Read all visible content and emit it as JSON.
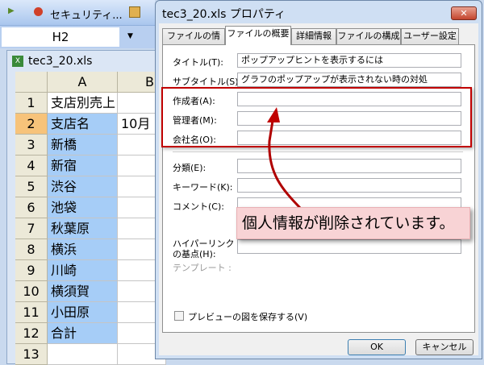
{
  "toolbar": {
    "security_label": "セキュリティ..."
  },
  "namebox": {
    "value": "H2"
  },
  "workbook": {
    "title": "tec3_20.xls",
    "col_a": "A",
    "col_b": "B",
    "rows": [
      {
        "n": "1",
        "a": "支店別売上",
        "b": ""
      },
      {
        "n": "2",
        "a": "支店名",
        "b": "10月"
      },
      {
        "n": "3",
        "a": "新橋",
        "b": ""
      },
      {
        "n": "4",
        "a": "新宿",
        "b": ""
      },
      {
        "n": "5",
        "a": "渋谷",
        "b": ""
      },
      {
        "n": "6",
        "a": "池袋",
        "b": ""
      },
      {
        "n": "7",
        "a": "秋葉原",
        "b": ""
      },
      {
        "n": "8",
        "a": "横浜",
        "b": ""
      },
      {
        "n": "9",
        "a": "川崎",
        "b": ""
      },
      {
        "n": "10",
        "a": "横須賀",
        "b": ""
      },
      {
        "n": "11",
        "a": "小田原",
        "b": ""
      },
      {
        "n": "12",
        "a": "合計",
        "b": ""
      },
      {
        "n": "13",
        "a": "",
        "b": ""
      }
    ]
  },
  "dialog": {
    "title": "tec3_20.xls プロパティ",
    "close": "✕",
    "tabs": [
      "ファイルの情報",
      "ファイルの概要",
      "詳細情報",
      "ファイルの構成",
      "ユーザー設定"
    ],
    "fields": {
      "title_label": "タイトル(T):",
      "title_value": "ポップアップヒントを表示するには",
      "subtitle_label": "サブタイトル(S):",
      "subtitle_value": "グラフのポップアップが表示されない時の対処",
      "author_label": "作成者(A):",
      "manager_label": "管理者(M):",
      "company_label": "会社名(O):",
      "category_label": "分類(E):",
      "keyword_label": "キーワード(K):",
      "comment_label": "コメント(C):",
      "hyperlink_label1": "ハイパーリンク",
      "hyperlink_label2": "の基点(H):",
      "template_label": "テンプレート :"
    },
    "preview_checkbox": "プレビューの図を保存する(V)",
    "ok": "OK",
    "cancel": "キャンセル"
  },
  "callout": {
    "text": "個人情報が削除されています。"
  },
  "colors": {
    "accent_red": "#c00000",
    "callout_bg": "#f8d3d5",
    "selection": "#a6cdf7"
  }
}
